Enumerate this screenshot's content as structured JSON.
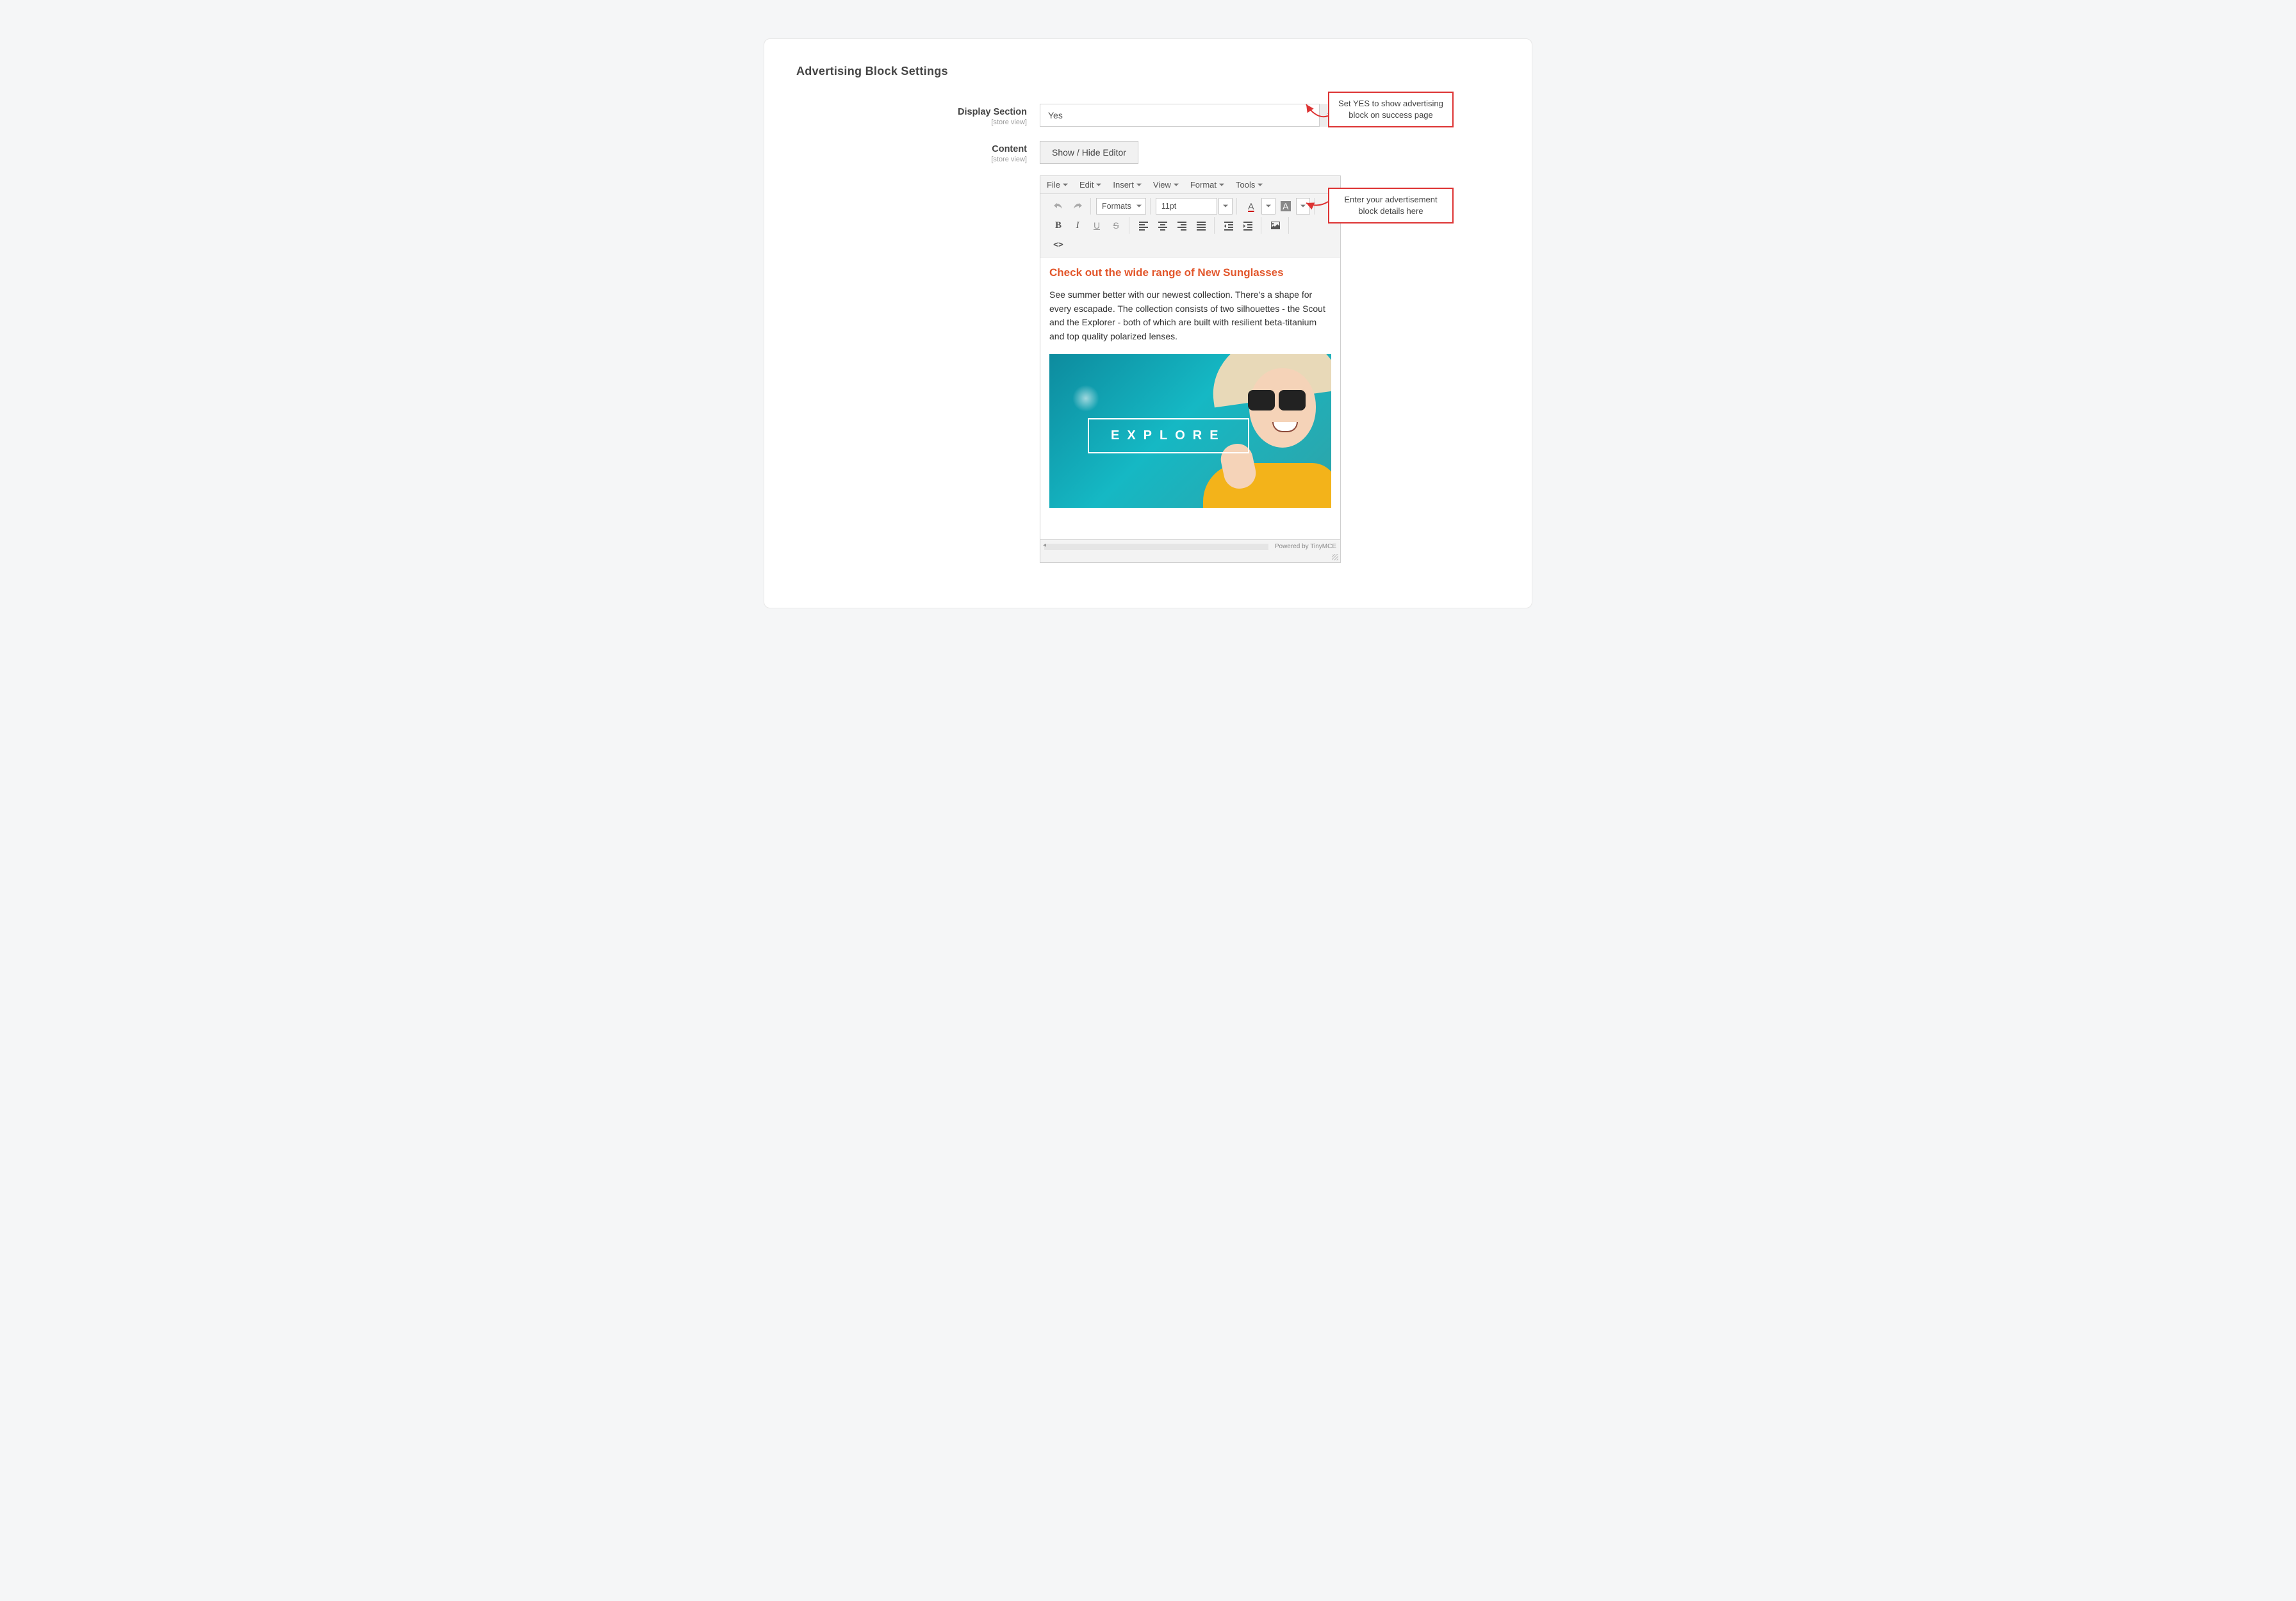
{
  "page_title": "Advertising Block Settings",
  "fields": {
    "display_section": {
      "label": "Display Section",
      "scope": "[store view]",
      "value": "Yes"
    },
    "content": {
      "label": "Content",
      "scope": "[store view]",
      "toggle_button": "Show / Hide Editor"
    }
  },
  "editor": {
    "menubar": [
      "File",
      "Edit",
      "Insert",
      "View",
      "Format",
      "Tools"
    ],
    "toolbar": {
      "formats_label": "Formats",
      "fontsize_value": "11pt"
    },
    "content_heading": "Check out the wide range of New Sunglasses",
    "content_paragraph": "See summer better with our newest collection. There's a shape for every escapade. The collection consists of two silhouettes - the Scout and the Explorer - both of which are built with resilient beta-titanium and top quality polarized lenses.",
    "banner_cta": "EXPLORE",
    "powered_by": "Powered by TinyMCE"
  },
  "callouts": {
    "display_section": "Set YES to show advertising block on success page",
    "content": "Enter your advertisement block details here"
  }
}
